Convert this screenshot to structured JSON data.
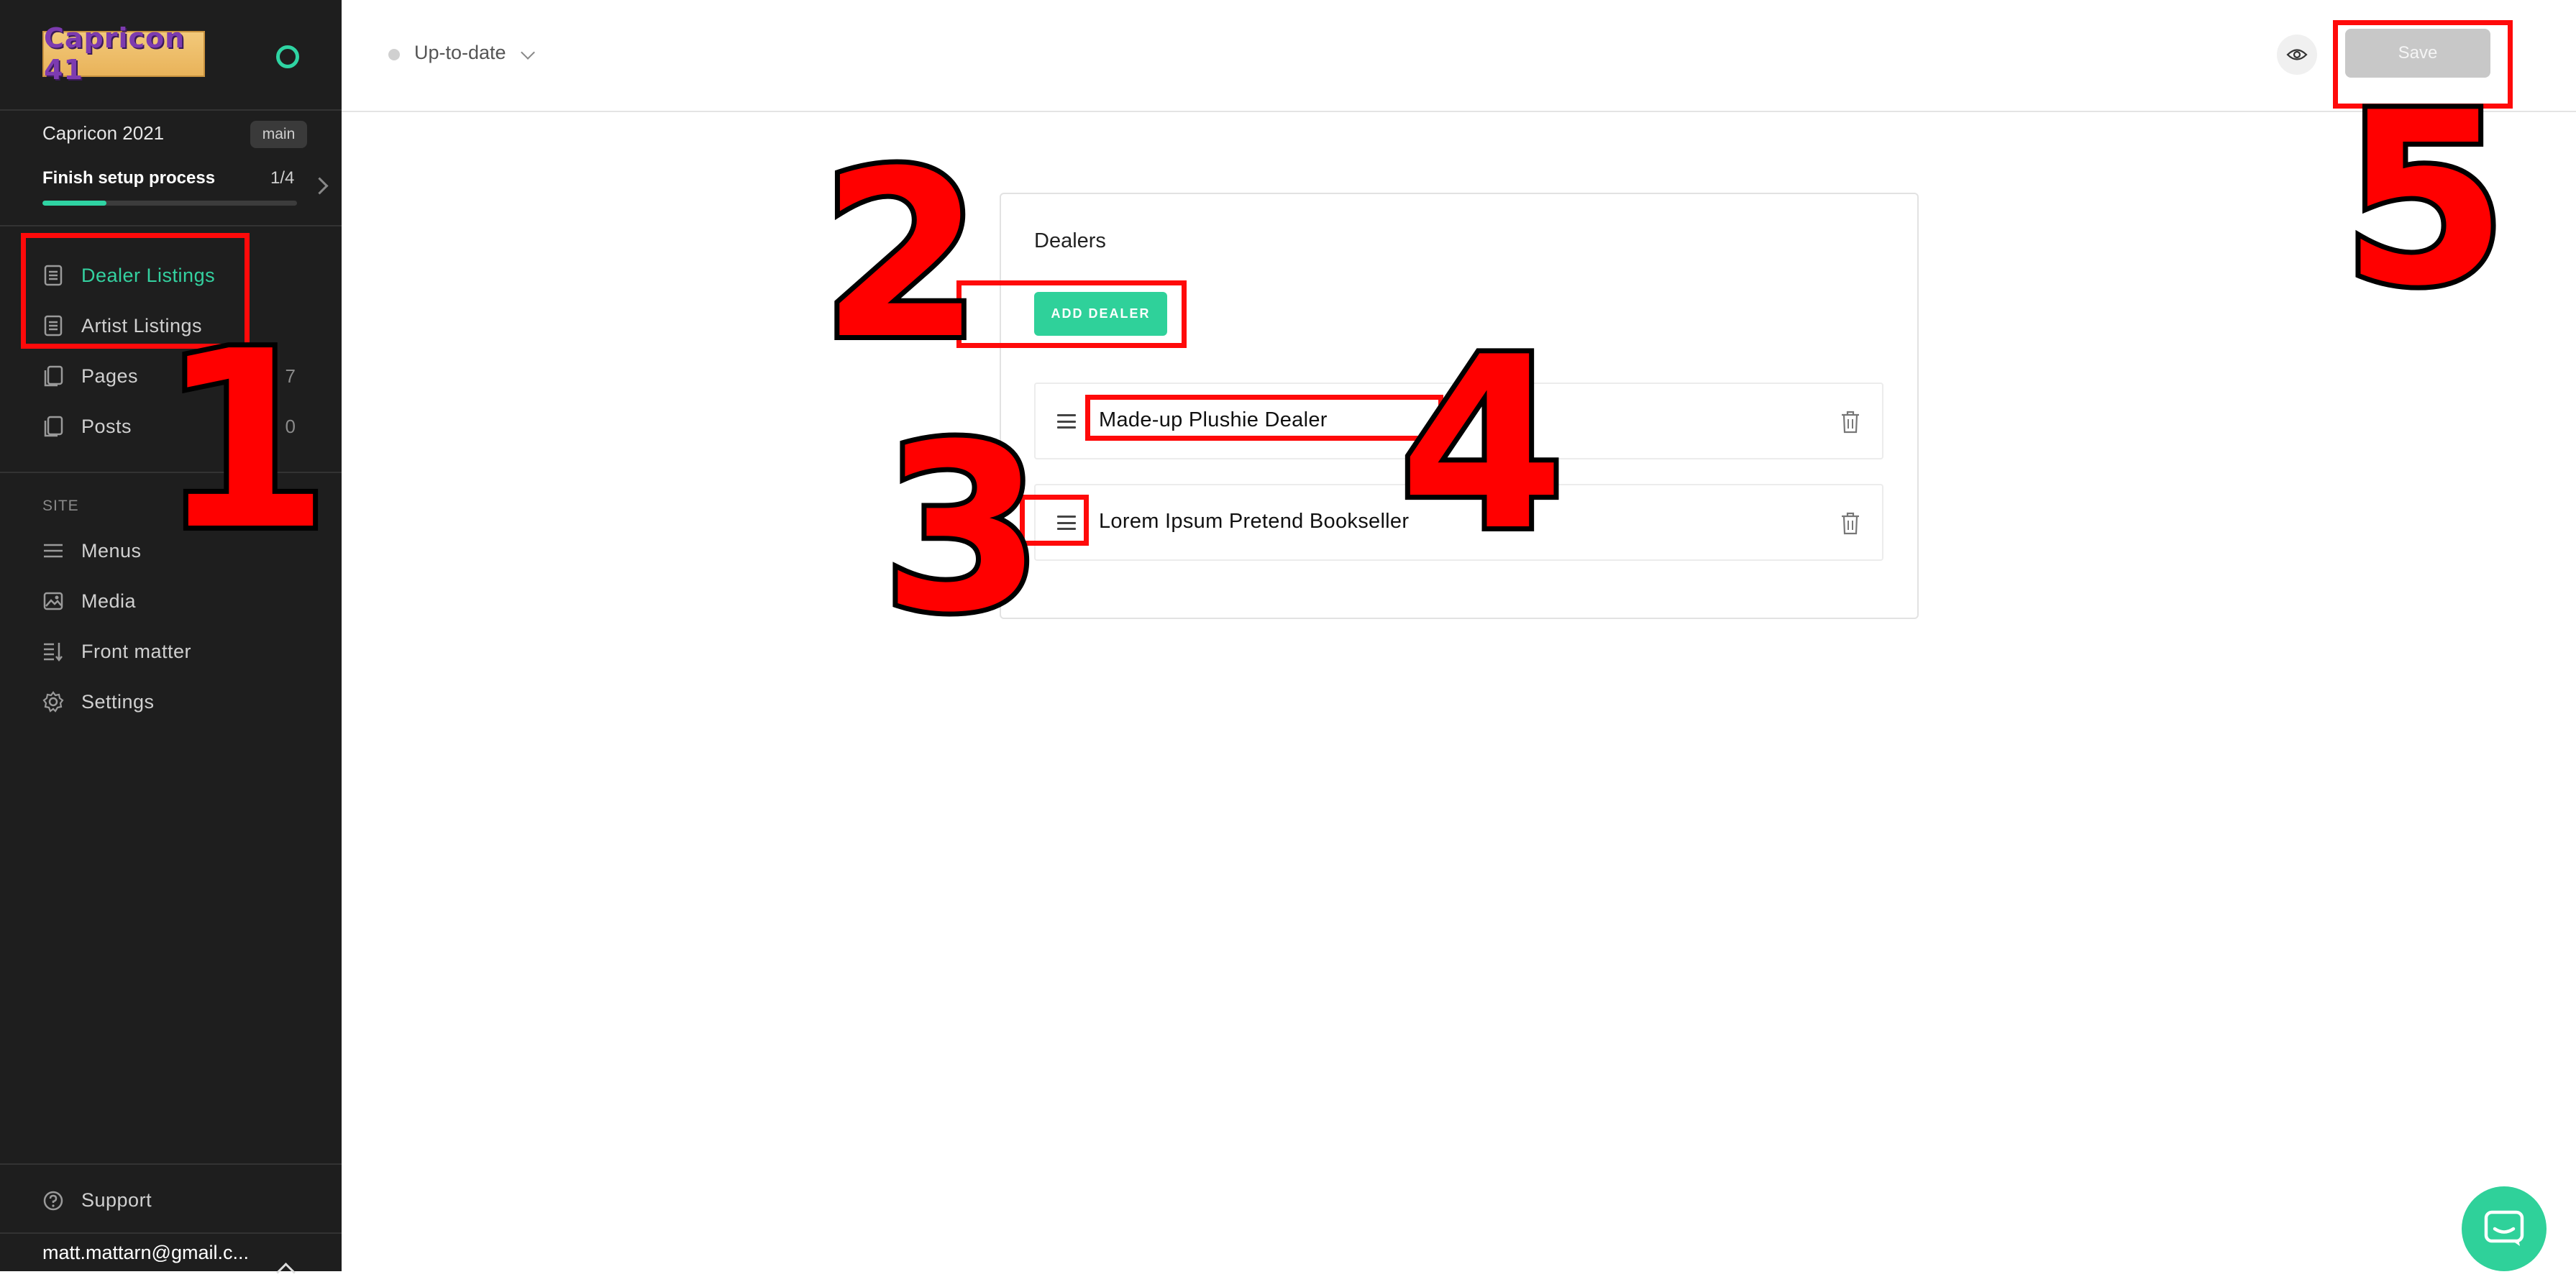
{
  "sidebar": {
    "logo_text": "Capricon 41",
    "site_name": "Capricon 2021",
    "branch": "main",
    "setup": {
      "label": "Finish setup process",
      "count": "1/4",
      "progress": 0.25
    },
    "items": [
      {
        "label": "Dealer Listings",
        "count": "",
        "icon": "document-icon",
        "active": true
      },
      {
        "label": "Artist Listings",
        "count": "",
        "icon": "document-icon",
        "active": false
      },
      {
        "label": "Pages",
        "count": "7",
        "icon": "pages-icon",
        "active": false
      },
      {
        "label": "Posts",
        "count": "0",
        "icon": "pages-icon",
        "active": false
      }
    ],
    "section_label": "SITE",
    "site_items": [
      {
        "label": "Menus",
        "icon": "menu-icon"
      },
      {
        "label": "Media",
        "icon": "image-icon"
      },
      {
        "label": "Front matter",
        "icon": "front-matter-icon"
      },
      {
        "label": "Settings",
        "icon": "gear-icon"
      }
    ],
    "support_label": "Support",
    "user_email": "matt.mattarn@gmail.c..."
  },
  "topbar": {
    "status": "Up-to-date",
    "save_label": "Save"
  },
  "main": {
    "card_title": "Dealers",
    "add_button_label": "ADD DEALER",
    "dealers": [
      {
        "name": "Made-up Plushie Dealer"
      },
      {
        "name": "Lorem Ipsum Pretend Bookseller"
      }
    ]
  },
  "annotations": {
    "labels": [
      "1",
      "2",
      "3",
      "4",
      "5"
    ]
  },
  "colors": {
    "accent": "#2fd19a",
    "sidebar_bg": "#1e1e1e",
    "annotation": "#ff0000"
  }
}
